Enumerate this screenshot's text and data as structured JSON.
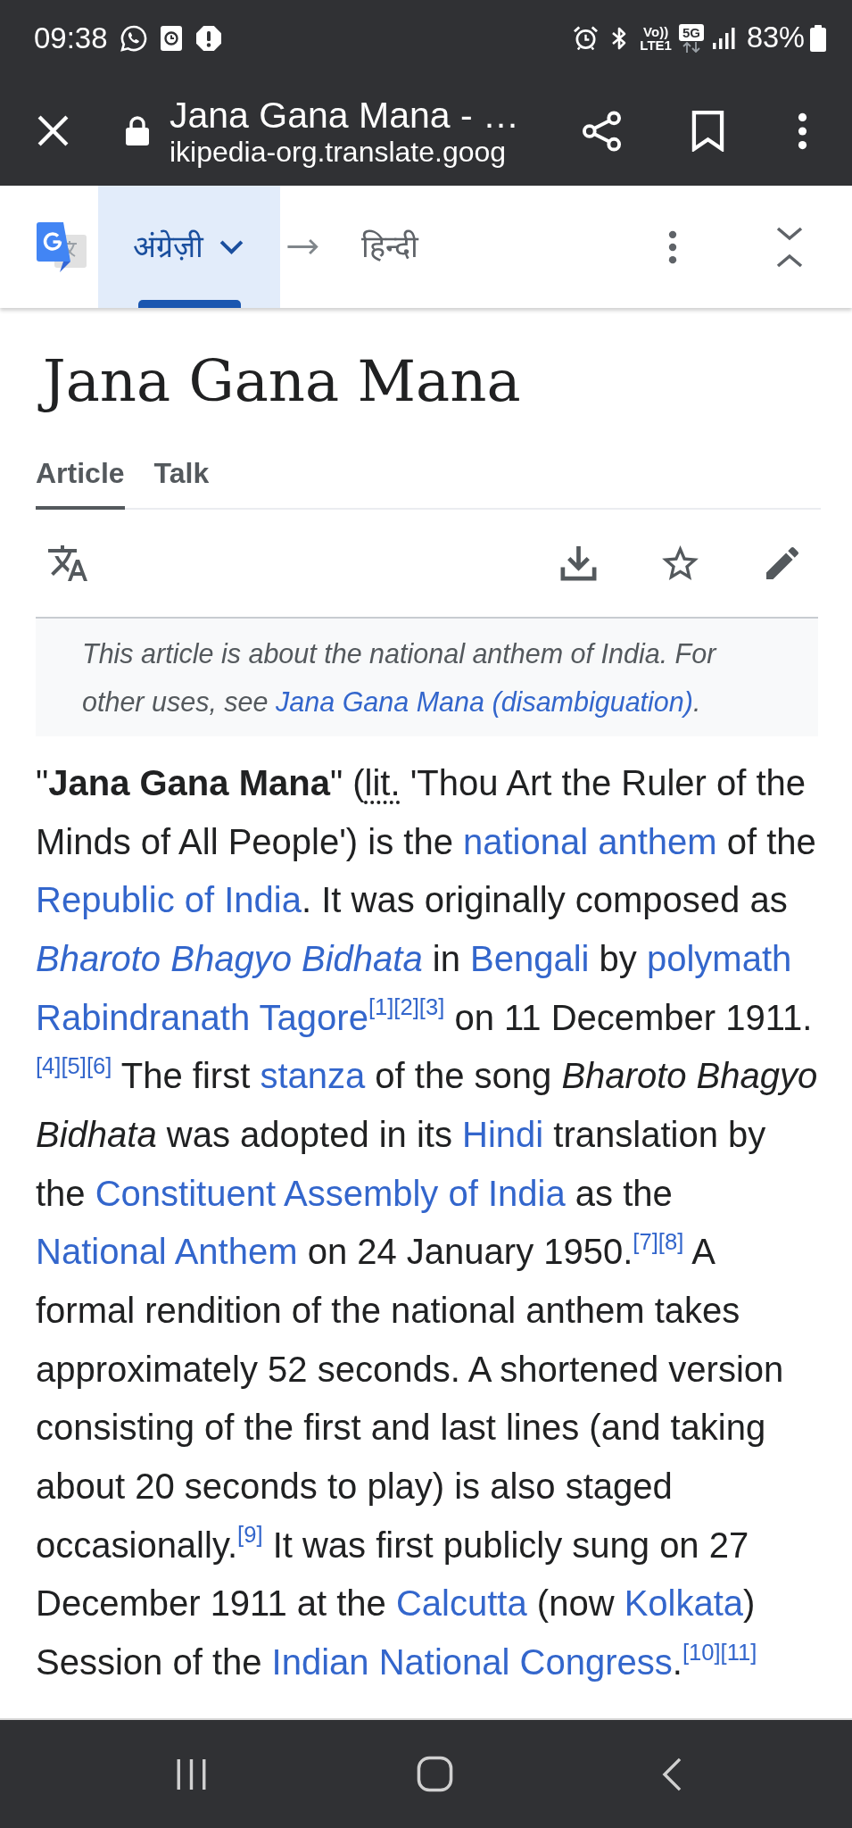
{
  "status_bar": {
    "time": "09:38",
    "volte_lines": [
      "Vo))",
      "LTE1"
    ],
    "network_type": "5G",
    "battery": "83%"
  },
  "browser_bar": {
    "title": "Jana Gana Mana - …",
    "url": "ikipedia-org.translate.goog"
  },
  "translate_bar": {
    "languages": [
      {
        "label": "अंग्रेज़ी",
        "selected": true
      },
      {
        "label": "हिन्दी",
        "selected": false
      }
    ]
  },
  "article": {
    "title": "Jana Gana Mana",
    "tabs": [
      {
        "label": "Article",
        "selected": true
      },
      {
        "label": "Talk",
        "selected": false
      }
    ],
    "hatnote": [
      {
        "kind": "text",
        "text": "This article is about the national anthem of India. For other uses, see "
      },
      {
        "kind": "link",
        "text": "Jana Gana Mana (disambiguation)"
      },
      {
        "kind": "text",
        "text": "."
      }
    ],
    "paragraph": [
      {
        "kind": "text",
        "text": "\"**Jana Gana Mana**\" ("
      },
      {
        "kind": "abbr",
        "text": "lit."
      },
      {
        "kind": "text",
        "text": " 'Thou Art the Ruler of the Minds of All People') is the "
      },
      {
        "kind": "link",
        "text": "national anthem"
      },
      {
        "kind": "text",
        "text": " of the "
      },
      {
        "kind": "link",
        "text": "Republic of India"
      },
      {
        "kind": "text",
        "text": ". It was originally composed as "
      },
      {
        "kind": "link",
        "text": "*Bharoto Bhagyo Bidhata*"
      },
      {
        "kind": "text",
        "text": " in "
      },
      {
        "kind": "link",
        "text": "Bengali"
      },
      {
        "kind": "text",
        "text": " by "
      },
      {
        "kind": "link",
        "text": "polymath"
      },
      {
        "kind": "link",
        "text": "Rabindranath Tagore"
      },
      {
        "kind": "ref",
        "text": "[1]"
      },
      {
        "kind": "ref",
        "text": "[2]"
      },
      {
        "kind": "ref",
        "text": "[3]"
      },
      {
        "kind": "text",
        "text": " on 11 December 1911."
      },
      {
        "kind": "ref",
        "text": "[4]"
      },
      {
        "kind": "ref",
        "text": "[5]"
      },
      {
        "kind": "ref",
        "text": "[6]"
      },
      {
        "kind": "text",
        "text": " The first "
      },
      {
        "kind": "link",
        "text": "stanza"
      },
      {
        "kind": "text",
        "text": " of the song *Bharoto Bhagyo Bidhata* was adopted in its "
      },
      {
        "kind": "link",
        "text": "Hindi"
      },
      {
        "kind": "text",
        "text": " translation by the "
      },
      {
        "kind": "link",
        "text": "Constituent Assembly of India"
      },
      {
        "kind": "text",
        "text": " as the "
      },
      {
        "kind": "link",
        "text": "National Anthem"
      },
      {
        "kind": "text",
        "text": " on 24 January 1950."
      },
      {
        "kind": "ref",
        "text": "[7]"
      },
      {
        "kind": "ref",
        "text": "[8]"
      },
      {
        "kind": "text",
        "text": " A formal rendition of the national anthem takes approximately 52 seconds. A shortened version consisting of the first and last lines (and taking about 20 seconds to play) is also staged occasionally."
      },
      {
        "kind": "ref",
        "text": "[9]"
      },
      {
        "kind": "text",
        "text": " It was first publicly sung on 27 December 1911 at the "
      },
      {
        "kind": "link",
        "text": "Calcutta"
      },
      {
        "kind": "text",
        "text": " (now "
      },
      {
        "kind": "link",
        "text": "Kolkata"
      },
      {
        "kind": "text",
        "text": ") Session of the "
      },
      {
        "kind": "link",
        "text": "Indian National Congress"
      },
      {
        "kind": "text",
        "text": "."
      },
      {
        "kind": "ref",
        "text": "[10]"
      },
      {
        "kind": "ref",
        "text": "[11]"
      }
    ]
  }
}
